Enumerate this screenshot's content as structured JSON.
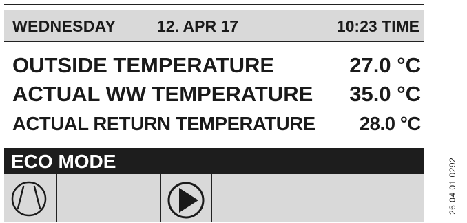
{
  "header": {
    "day": "WEDNESDAY",
    "date": "12. APR 17",
    "time": "10:23 TIME"
  },
  "readings": [
    {
      "label": "OUTSIDE TEMPERATURE",
      "value": "27.0 °C"
    },
    {
      "label": "ACTUAL WW TEMPERATURE",
      "value": "35.0 °C"
    },
    {
      "label": "ACTUAL RETURN TEMPERATURE",
      "value": "28.0 °C"
    }
  ],
  "mode": {
    "label": "ECO MODE"
  },
  "icons": {
    "cell1": "compressor-icon",
    "cell3": "pump-icon"
  },
  "figure_code": "26 04 01 0292",
  "colors": {
    "background": "#ffffff",
    "panel": "#d9d9d9",
    "mode_bar": "#1d1d1d"
  }
}
